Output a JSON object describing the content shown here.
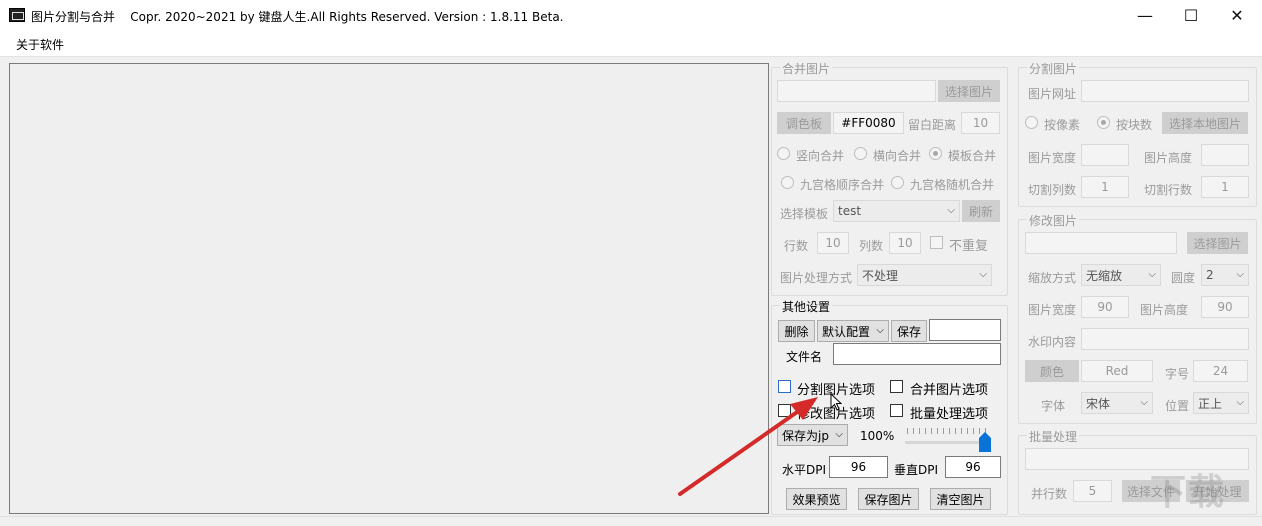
{
  "window": {
    "title": "图片分割与合并",
    "copyright": "Copr. 2020~2021 by 键盘人生.All Rights Reserved.  Version : 1.8.11 Beta.",
    "minimize": "—",
    "maximize": "☐",
    "close": "✕"
  },
  "menu": {
    "about": "关于软件"
  },
  "merge": {
    "title": "合并图片",
    "select_image": "选择图片",
    "palette": "调色板",
    "color_value": "#FF0080",
    "margin_label": "留白距离",
    "margin_value": "10",
    "vertical": "竖向合并",
    "horizontal": "横向合并",
    "template": "模板合并",
    "grid_seq": "九宫格顺序合并",
    "grid_random": "九宫格随机合并",
    "choose_template": "选择模板",
    "template_value": "test",
    "refresh": "刷新",
    "rows_label": "行数",
    "rows_value": "10",
    "cols_label": "列数",
    "cols_value": "10",
    "no_repeat": "不重复",
    "process_label": "图片处理方式",
    "process_value": "不处理"
  },
  "other": {
    "title": "其他设置",
    "delete": "删除",
    "config_value": "默认配置",
    "save": "保存",
    "filename_label": "文件名",
    "split_option": "分割图片选项",
    "merge_option": "合并图片选项",
    "modify_option": "修改图片选项",
    "batch_option": "批量处理选项",
    "save_as": "保存为jp",
    "zoom": "100%",
    "hdpi_label": "水平DPI",
    "hdpi_value": "96",
    "vdpi_label": "垂直DPI",
    "vdpi_value": "96",
    "preview": "效果预览",
    "save_image": "保存图片",
    "clear_image": "清空图片",
    "slider_fraction": 1.0
  },
  "split": {
    "title": "分割图片",
    "url_label": "图片网址",
    "by_pixel": "按像素",
    "by_block": "按块数",
    "select_local": "选择本地图片",
    "width_label": "图片宽度",
    "height_label": "图片高度",
    "cols_label": "切割列数",
    "cols_value": "1",
    "rows_label": "切割行数",
    "rows_value": "1"
  },
  "modify": {
    "title": "修改图片",
    "select_image": "选择图片",
    "scale_label": "缩放方式",
    "scale_value": "无缩放",
    "rotate_label": "圆度",
    "rotate_value": "2",
    "width_label": "图片宽度",
    "width_value": "90",
    "height_label": "图片高度",
    "height_value": "90",
    "watermark_label": "水印内容",
    "color_btn": "颜色",
    "color_value": "Red",
    "size_label": "字号",
    "size_value": "24",
    "font_label": "字体",
    "font_value": "宋体",
    "position_label": "位置",
    "position_value": "正上"
  },
  "batch": {
    "title": "批量处理",
    "parallel_label": "并行数",
    "parallel_value": "5",
    "select_btn": "选择文件",
    "process_btn": "开始处理"
  },
  "watermark_text": "下载"
}
